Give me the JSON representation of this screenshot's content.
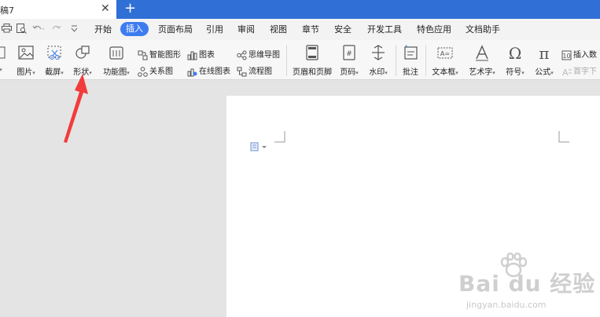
{
  "tabbar": {
    "doc_tab_title": "稿7",
    "close_glyph": "✕",
    "new_tab_glyph": "+"
  },
  "menubar": {
    "quick_access_icons": [
      "print-icon",
      "print-preview-icon",
      "undo-icon",
      "redo-icon",
      "customize-icon"
    ],
    "items": [
      "开始",
      "插入",
      "页面布局",
      "引用",
      "审阅",
      "视图",
      "章节",
      "安全",
      "开发工具",
      "特色应用",
      "文档助手"
    ],
    "active": "插入"
  },
  "ribbon": {
    "large_buttons": [
      {
        "label": "图片",
        "icon": "picture-icon"
      },
      {
        "label": "截屏",
        "icon": "screenshot-icon"
      },
      {
        "label": "形状",
        "icon": "shapes-icon"
      },
      {
        "label": "功能图",
        "icon": "function-chart-icon"
      },
      {
        "label": "页眉和页脚",
        "icon": "header-footer-icon"
      },
      {
        "label": "页码",
        "icon": "page-number-icon"
      },
      {
        "label": "水印",
        "icon": "watermark-icon"
      },
      {
        "label": "批注",
        "icon": "comment-icon"
      },
      {
        "label": "文本框",
        "icon": "textbox-icon"
      },
      {
        "label": "艺术字",
        "icon": "wordart-icon"
      },
      {
        "label": "符号",
        "icon": "symbol-omega-icon"
      },
      {
        "label": "公式",
        "icon": "formula-pi-icon"
      }
    ],
    "small_buttons": {
      "smart_shape": "智能图形",
      "chart": "图表",
      "mind_map": "思维导图",
      "relation": "关系图",
      "online_chart": "在线图表",
      "flowchart": "流程图",
      "insert_number": "插入数",
      "first_letter": "首字下"
    }
  },
  "document": {
    "paste_options_icon": "paste-options-icon"
  },
  "annotation": {
    "arrow_color": "#f23b3b"
  },
  "watermark": {
    "brand": "Bai du 经验",
    "url": "jingyan.baidu.com"
  },
  "colors": {
    "accent": "#3d7cf0",
    "tabbar": "#2f6fd6"
  }
}
